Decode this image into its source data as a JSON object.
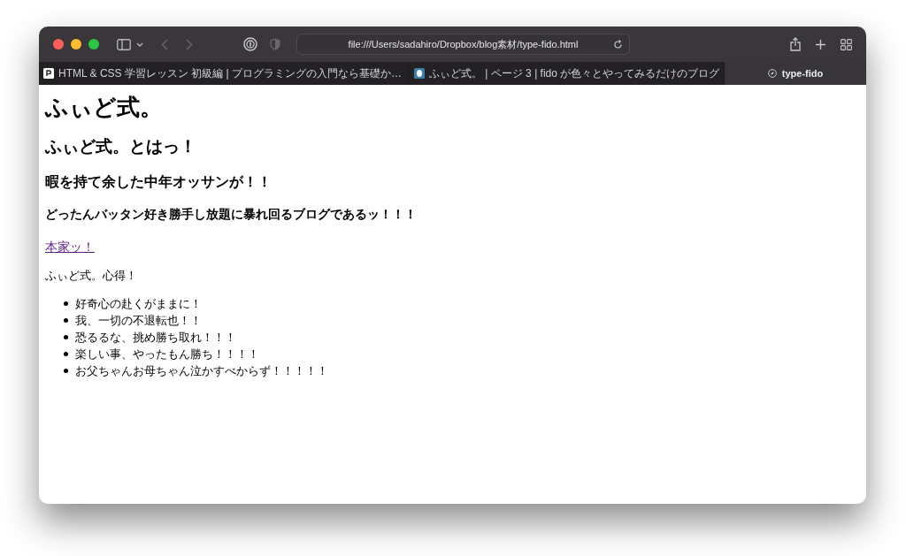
{
  "toolbar": {
    "url": "file:///Users/sadahiro/Dropbox/blog素材/type-fido.html"
  },
  "tabs": [
    {
      "label": "HTML & CSS 学習レッスン 初級編 | プログラミングの入門なら基礎か…",
      "selected": false
    },
    {
      "label": "ふぃど式。 | ページ 3 | fido が色々とやってみるだけのブログ",
      "selected": false
    },
    {
      "label": "type-fido",
      "selected": true
    }
  ],
  "page": {
    "headings": [
      {
        "kind": "title",
        "text": "ふぃど式。"
      },
      {
        "kind": "section",
        "text": "ふぃど式。とはっ！"
      },
      {
        "kind": "subsection",
        "text": "暇を持て余した中年オッサンが！！"
      },
      {
        "kind": "tagline",
        "text": "どったんバッタン好き勝手し放題に暴れ回るブログであるッ！！！"
      }
    ],
    "link": "本家ッ！",
    "paragraph": "ふぃど式。心得！",
    "list": [
      "好奇心の赴くがままに！",
      "我、一切の不退転也！！",
      "恐るるな、挑め勝ち取れ！！！",
      "楽しい事、やったもん勝ち！！！！",
      "お父ちゃんお母ちゃん泣かすべからず！！！！！"
    ]
  }
}
